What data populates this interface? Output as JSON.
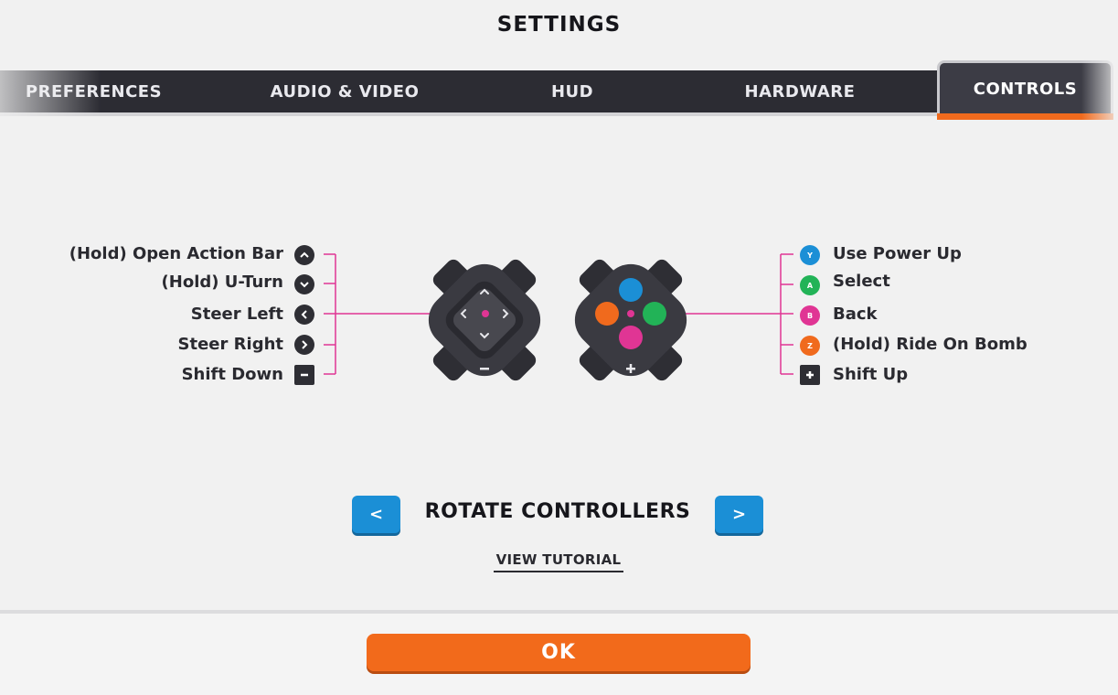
{
  "header": {
    "title": "SETTINGS"
  },
  "tabs": [
    {
      "label": "PREFERENCES"
    },
    {
      "label": "AUDIO & VIDEO"
    },
    {
      "label": "HUD"
    },
    {
      "label": "HARDWARE"
    },
    {
      "label": "CONTROLS",
      "active": true
    }
  ],
  "left_controller": {
    "mappings": [
      {
        "label": "(Hold) Open Action Bar",
        "icon": "chevron-up-icon"
      },
      {
        "label": "(Hold) U-Turn",
        "icon": "chevron-down-icon"
      },
      {
        "label": "Steer Left",
        "icon": "chevron-left-icon"
      },
      {
        "label": "Steer Right",
        "icon": "chevron-right-icon"
      },
      {
        "label": "Shift Down",
        "icon": "minus-icon"
      }
    ]
  },
  "right_controller": {
    "mappings": [
      {
        "label": "Use Power Up",
        "button": "Y",
        "color": "#1b8fd6"
      },
      {
        "label": "Select",
        "button": "A",
        "color": "#22b357"
      },
      {
        "label": "Back",
        "button": "B",
        "color": "#e03594"
      },
      {
        "label": "(Hold) Ride On Bomb",
        "button": "Z",
        "color": "#f06a1d"
      },
      {
        "label": "Shift Up",
        "icon": "plus-icon"
      }
    ]
  },
  "rotate": {
    "label": "ROTATE CONTROLLERS",
    "prev": "<",
    "next": ">"
  },
  "tutorial_link": "VIEW TUTORIAL",
  "footer": {
    "ok_label": "OK"
  },
  "colors": {
    "accent": "#f06a1d",
    "blue": "#1b8fd6",
    "line": "#e03594",
    "dark": "#2c2c33"
  }
}
